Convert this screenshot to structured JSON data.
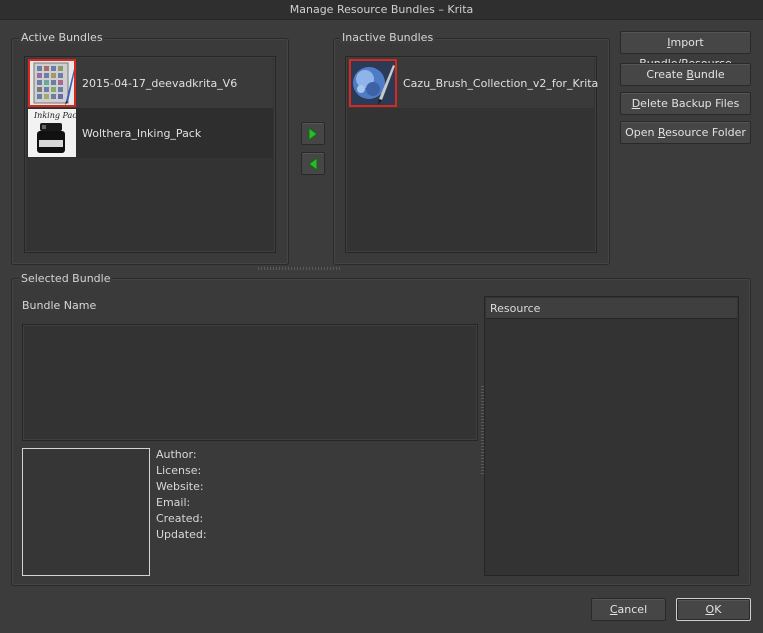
{
  "window": {
    "title": "Manage Resource Bundles – Krita"
  },
  "active_bundles": {
    "title": "Active Bundles",
    "items": [
      {
        "label": "2015-04-17_deevadkrita_V6",
        "icon": "palette-grid-icon"
      },
      {
        "label": "Wolthera_Inking_Pack",
        "icon": "ink-bottle-icon"
      }
    ]
  },
  "inactive_bundles": {
    "title": "Inactive Bundles",
    "items": [
      {
        "label": "Cazu_Brush_Collection_v2_for_Krita",
        "icon": "brush-splash-icon"
      }
    ]
  },
  "transfer": {
    "activate_icon": "arrow-right-icon",
    "deactivate_icon": "arrow-left-icon"
  },
  "actions": {
    "import": {
      "pre": "",
      "ul": "I",
      "post": "mport Bundle/Resource"
    },
    "create": {
      "pre": "Create ",
      "ul": "B",
      "post": "undle"
    },
    "delete_backup": {
      "pre": "",
      "ul": "D",
      "post": "elete Backup Files"
    },
    "open_folder": {
      "pre": "Open ",
      "ul": "R",
      "post": "esource Folder"
    }
  },
  "selected_bundle": {
    "title": "Selected Bundle",
    "bundle_name_label": "Bundle Name",
    "author_label": "Author:",
    "license_label": "License:",
    "website_label": "Website:",
    "email_label": "Email:",
    "created_label": "Created:",
    "updated_label": "Updated:",
    "resource_header": "Resource"
  },
  "dialog_buttons": {
    "cancel": {
      "ul": "C",
      "post": "ancel"
    },
    "ok": {
      "ul": "O",
      "post": "K"
    }
  },
  "colors": {
    "selection_outline": "#d9281f",
    "arrow_green": "#2db82d"
  }
}
